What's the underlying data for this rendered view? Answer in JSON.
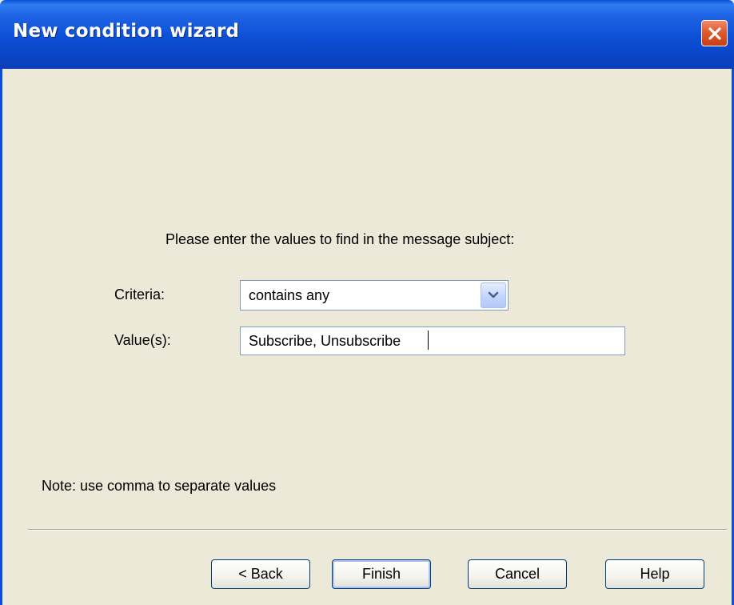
{
  "window": {
    "title": "New condition wizard",
    "close_icon": "close-icon"
  },
  "prompt": "Please enter the values to find in the message subject:",
  "criteria": {
    "label": "Criteria:",
    "value": "contains any",
    "arrow_icon": "chevron-down-icon"
  },
  "values_field": {
    "label": "Value(s):",
    "value": "Subscribe, Unsubscribe"
  },
  "note": "Note: use comma to separate values",
  "buttons": {
    "back": "< Back",
    "finish": "Finish",
    "cancel": "Cancel",
    "help": "Help"
  },
  "colors": {
    "titlebar": "#0a4fd8",
    "dialog_bg": "#ece9d8",
    "close_button": "#e05a2e",
    "field_border": "#7f9db9"
  }
}
